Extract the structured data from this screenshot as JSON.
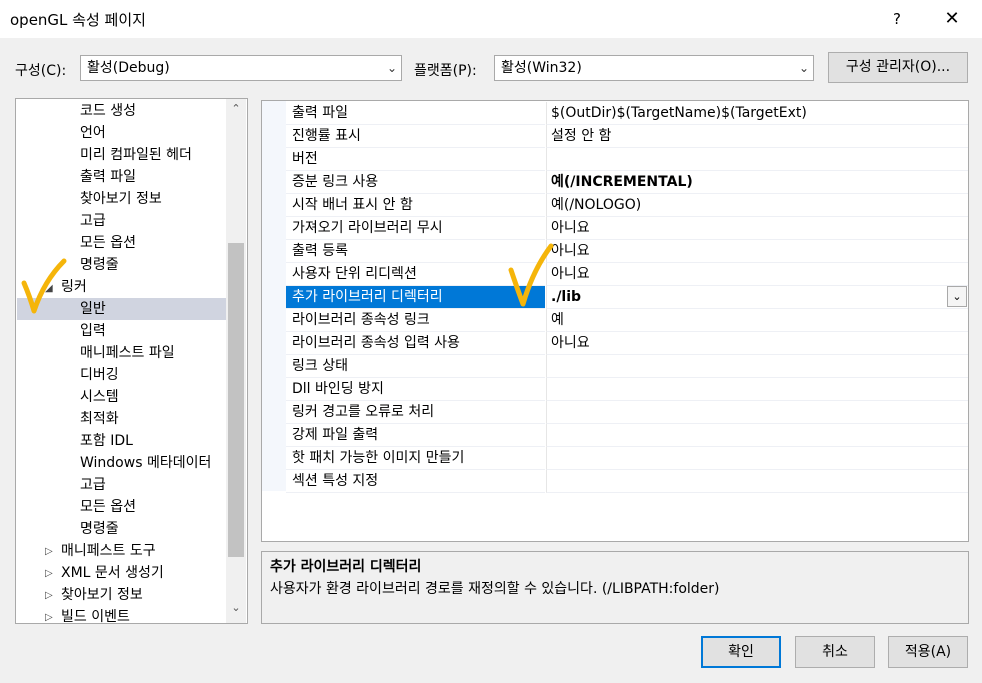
{
  "window": {
    "title": "openGL 속성 페이지",
    "help": "?",
    "close": "✕"
  },
  "config": {
    "config_label": "구성(C):",
    "config_value": "활성(Debug)",
    "platform_label": "플랫폼(P):",
    "platform_value": "활성(Win32)",
    "manager_button": "구성 관리자(O)..."
  },
  "tree": {
    "items": [
      {
        "label": "코드 생성"
      },
      {
        "label": "언어"
      },
      {
        "label": "미리 컴파일된 헤더"
      },
      {
        "label": "출력 파일"
      },
      {
        "label": "찾아보기 정보"
      },
      {
        "label": "고급"
      },
      {
        "label": "모든 옵션"
      },
      {
        "label": "명령줄"
      },
      {
        "label": "링커"
      },
      {
        "label": "일반"
      },
      {
        "label": "입력"
      },
      {
        "label": "매니페스트 파일"
      },
      {
        "label": "디버깅"
      },
      {
        "label": "시스템"
      },
      {
        "label": "최적화"
      },
      {
        "label": "포함 IDL"
      },
      {
        "label": "Windows 메타데이터"
      },
      {
        "label": "고급"
      },
      {
        "label": "모든 옵션"
      },
      {
        "label": "명령줄"
      },
      {
        "label": "매니페스트 도구"
      },
      {
        "label": "XML 문서 생성기"
      },
      {
        "label": "찾아보기 정보"
      },
      {
        "label": "빌드 이벤트"
      }
    ]
  },
  "grid": {
    "rows": [
      {
        "name": "출력 파일",
        "value": "$(OutDir)$(TargetName)$(TargetExt)"
      },
      {
        "name": "진행률 표시",
        "value": "설정 안 함"
      },
      {
        "name": "버전",
        "value": ""
      },
      {
        "name": "증분 링크 사용",
        "value": "예(/INCREMENTAL)"
      },
      {
        "name": "시작 배너 표시 안 함",
        "value": "예(/NOLOGO)"
      },
      {
        "name": "가져오기 라이브러리 무시",
        "value": "아니요"
      },
      {
        "name": "출력 등록",
        "value": "아니요"
      },
      {
        "name": "사용자 단위 리디렉션",
        "value": "아니요"
      },
      {
        "name": "추가 라이브러리 디렉터리",
        "value": "./lib"
      },
      {
        "name": "라이브러리 종속성 링크",
        "value": "예"
      },
      {
        "name": "라이브러리 종속성 입력 사용",
        "value": "아니요"
      },
      {
        "name": "링크 상태",
        "value": ""
      },
      {
        "name": "Dll 바인딩 방지",
        "value": ""
      },
      {
        "name": "링커 경고를 오류로 처리",
        "value": ""
      },
      {
        "name": "강제 파일 출력",
        "value": ""
      },
      {
        "name": "핫 패치 가능한 이미지 만들기",
        "value": ""
      },
      {
        "name": "섹션 특성 지정",
        "value": ""
      }
    ]
  },
  "description": {
    "title": "추가 라이브러리 디렉터리",
    "text": "사용자가 환경 라이브러리 경로를 재정의할 수 있습니다. (/LIBPATH:folder)"
  },
  "buttons": {
    "ok": "확인",
    "cancel": "취소",
    "apply": "적용(A)"
  },
  "colors": {
    "selection": "#0078d7",
    "checkmark": "#f5b50a"
  }
}
